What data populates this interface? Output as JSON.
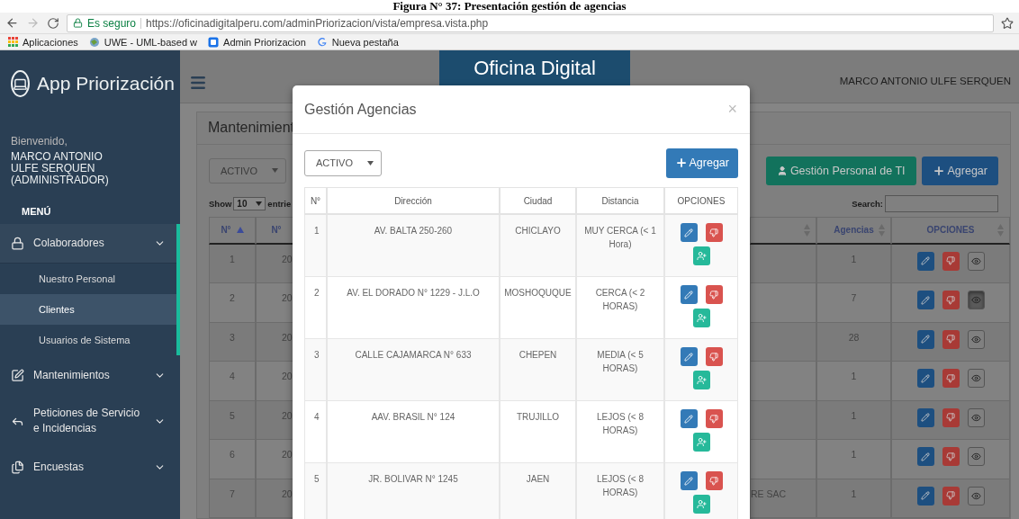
{
  "caption": "Figura N° 37: Presentación gestión de agencias",
  "browser": {
    "security": "Es seguro",
    "url": "https://oficinadigitalperu.com/adminPriorizacion/vista/empresa.vista.php",
    "bookmarks": [
      {
        "kind": "apps",
        "label": "Aplicaciones"
      },
      {
        "kind": "site",
        "label": "UWE - UML-based w"
      },
      {
        "kind": "page",
        "label": "Admin Priorizacion"
      },
      {
        "kind": "google",
        "label": "Nueva pestaña"
      }
    ]
  },
  "app": {
    "brand": "App Priorización",
    "logo": "Oficina Digital",
    "user": "MARCO ANTONIO ULFE SERQUEN"
  },
  "sidebar": {
    "welcome": "Bienvenido,",
    "user_name": "MARCO ANTONIO ULFE SERQUEN (ADMINISTRADOR)",
    "menu_title": "MENÚ",
    "items": [
      {
        "label": "Colaboradores",
        "expanded": true,
        "children": [
          {
            "label": "Nuestro Personal",
            "selected": false
          },
          {
            "label": "Clientes",
            "selected": true
          },
          {
            "label": "Usuarios de Sistema",
            "selected": false
          }
        ]
      },
      {
        "label": "Mantenimientos",
        "expanded": false
      },
      {
        "label": "Peticiones de Servicio e Incidencias",
        "expanded": false
      },
      {
        "label": "Encuestas",
        "expanded": false
      }
    ]
  },
  "page": {
    "title": "Mantenimient",
    "status_filter": "ACTIVO",
    "show_label": "Show",
    "page_size": "10",
    "entries_label": "entrie",
    "staff_button": "Gestión Personal de TI",
    "add_button": "Agregar",
    "search_label": "Search:",
    "columns": [
      {
        "label": "N°",
        "sorted": true
      },
      {
        "label": "N°"
      },
      {
        "sorted": false
      },
      {
        "label": "Agencias",
        "sorted": false
      },
      {
        "label": "OPCIONES",
        "sorted": false
      }
    ],
    "rows": [
      {
        "n": "1",
        "code": "20",
        "agencias": "1",
        "view_pressed": false
      },
      {
        "n": "2",
        "code": "20",
        "agencias": "7",
        "view_pressed": true
      },
      {
        "n": "3",
        "code": "20",
        "agencias": "28",
        "view_pressed": false
      },
      {
        "n": "4",
        "code": "20",
        "agencias": "1",
        "view_pressed": false
      },
      {
        "n": "5",
        "code": "20",
        "agencias": "1",
        "view_pressed": false
      },
      {
        "n": "6",
        "code": "20",
        "agencias": "1",
        "view_pressed": false
      },
      {
        "n": "7",
        "code": "20",
        "name": "RE SAC",
        "agencias": "1",
        "view_pressed": false
      }
    ]
  },
  "modal": {
    "title": "Gestión Agencias",
    "close": "×",
    "status_filter": "ACTIVO",
    "add_button": "Agregar",
    "columns": [
      "N°",
      "Dirección",
      "Ciudad",
      "Distancia",
      "OPCIONES"
    ],
    "rows": [
      {
        "n": "1",
        "address": "AV. BALTA 250-260",
        "city": "CHICLAYO",
        "distance": "MUY CERCA (< 1 Hora)"
      },
      {
        "n": "2",
        "address": "AV. EL DORADO N° 1229 - J.L.O",
        "city": "MOSHOQUQUE",
        "distance": "CERCA (< 2 HORAS)"
      },
      {
        "n": "3",
        "address": "CALLE CAJAMARCA N° 633",
        "city": "CHEPEN",
        "distance": "MEDIA (< 5 HORAS)"
      },
      {
        "n": "4",
        "address": "AAV. BRASIL N° 124",
        "city": "TRUJILLO",
        "distance": "LEJOS (< 8 HORAS)"
      },
      {
        "n": "5",
        "address": "JR. BOLIVAR N° 1245",
        "city": "JAEN",
        "distance": "LEJOS (< 8 HORAS)"
      }
    ]
  }
}
